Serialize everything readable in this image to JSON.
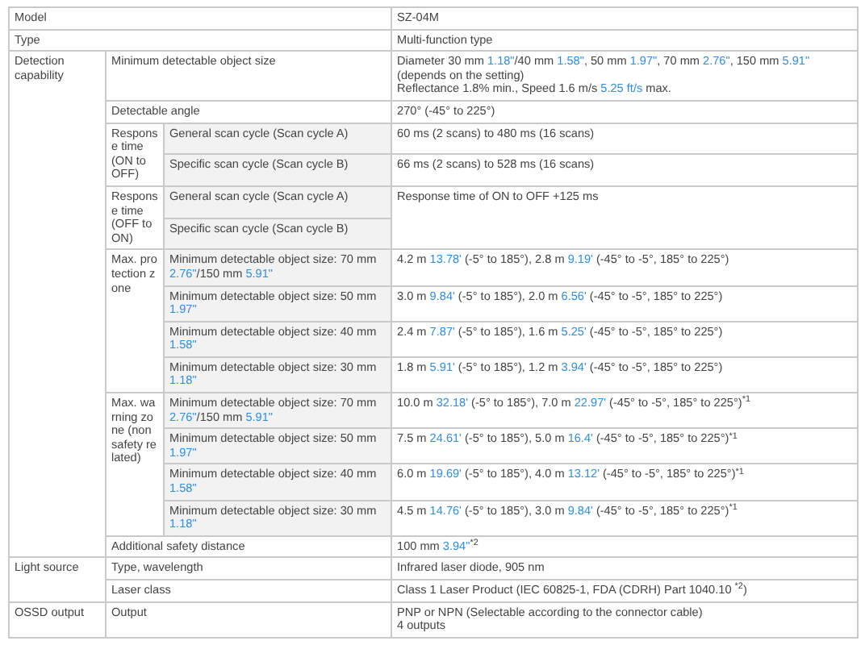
{
  "spec_table": [
    {
      "label": "Model",
      "value": [
        {
          "kind": "text",
          "text": "SZ-04M"
        }
      ]
    },
    {
      "label": "Type",
      "value": [
        {
          "kind": "text",
          "text": "Multi-function type"
        }
      ]
    },
    {
      "label": "Detection capability",
      "items": [
        {
          "label": "Minimum detectable object size",
          "value": [
            {
              "kind": "text",
              "text": "Diameter 30 mm "
            },
            {
              "kind": "imperial",
              "text": "1.18\""
            },
            {
              "kind": "text",
              "text": "/40 mm "
            },
            {
              "kind": "imperial",
              "text": "1.58\""
            },
            {
              "kind": "text",
              "text": ", 50 mm "
            },
            {
              "kind": "imperial",
              "text": "1.97\""
            },
            {
              "kind": "text",
              "text": ", 70 mm "
            },
            {
              "kind": "imperial",
              "text": "2.76\""
            },
            {
              "kind": "text",
              "text": ", 150 mm "
            },
            {
              "kind": "imperial",
              "text": "5.91\""
            },
            {
              "kind": "text",
              "text": " (depends on the setting)"
            },
            {
              "kind": "break"
            },
            {
              "kind": "text",
              "text": "Reflectance 1.8% min., Speed 1.6 m/s "
            },
            {
              "kind": "imperial",
              "text": "5.25 ft/s"
            },
            {
              "kind": "text",
              "text": " max."
            }
          ]
        },
        {
          "label": "Detectable angle",
          "value": [
            {
              "kind": "text",
              "text": "270° (-45° to 225°)"
            }
          ]
        },
        {
          "label": "Response time (ON to OFF)",
          "subitems": [
            {
              "label": "General scan cycle (Scan cycle A)",
              "value": [
                {
                  "kind": "text",
                  "text": "60 ms (2 scans) to 480 ms (16 scans)"
                }
              ]
            },
            {
              "label": "Specific scan cycle (Scan cycle B)",
              "value": [
                {
                  "kind": "text",
                  "text": "66 ms (2 scans) to 528 ms (16 scans)"
                }
              ]
            }
          ]
        },
        {
          "label": "Response time (OFF to ON)",
          "shared_value": [
            {
              "kind": "text",
              "text": "Response time of ON to OFF +125 ms"
            }
          ],
          "subitems": [
            {
              "label": "General scan cycle (Scan cycle A)"
            },
            {
              "label": "Specific scan cycle (Scan cycle B)"
            }
          ]
        },
        {
          "label": "Max. protection zone",
          "subitems": [
            {
              "label": [
                {
                  "kind": "text",
                  "text": "Minimum detectable object size: 70 mm "
                },
                {
                  "kind": "imperial",
                  "text": "2.76\""
                },
                {
                  "kind": "text",
                  "text": "/150 mm "
                },
                {
                  "kind": "imperial",
                  "text": "5.91\""
                }
              ],
              "value": [
                {
                  "kind": "text",
                  "text": "4.2 m "
                },
                {
                  "kind": "imperial",
                  "text": "13.78'"
                },
                {
                  "kind": "text",
                  "text": " (-5° to 185°), 2.8 m "
                },
                {
                  "kind": "imperial",
                  "text": "9.19'"
                },
                {
                  "kind": "text",
                  "text": " (-45° to -5°, 185° to 225°)"
                }
              ]
            },
            {
              "label": [
                {
                  "kind": "text",
                  "text": "Minimum detectable object size: 50 mm "
                },
                {
                  "kind": "imperial",
                  "text": "1.97\""
                }
              ],
              "value": [
                {
                  "kind": "text",
                  "text": "3.0 m "
                },
                {
                  "kind": "imperial",
                  "text": "9.84'"
                },
                {
                  "kind": "text",
                  "text": " (-5° to 185°), 2.0 m "
                },
                {
                  "kind": "imperial",
                  "text": "6.56'"
                },
                {
                  "kind": "text",
                  "text": " (-45° to -5°, 185° to 225°)"
                }
              ]
            },
            {
              "label": [
                {
                  "kind": "text",
                  "text": "Minimum detectable object size: 40 mm "
                },
                {
                  "kind": "imperial",
                  "text": "1.58\""
                }
              ],
              "value": [
                {
                  "kind": "text",
                  "text": "2.4 m "
                },
                {
                  "kind": "imperial",
                  "text": "7.87'"
                },
                {
                  "kind": "text",
                  "text": " (-5° to 185°), 1.6 m "
                },
                {
                  "kind": "imperial",
                  "text": "5.25'"
                },
                {
                  "kind": "text",
                  "text": " (-45° to -5°, 185° to 225°)"
                }
              ]
            },
            {
              "label": [
                {
                  "kind": "text",
                  "text": "Minimum detectable object size: 30 mm "
                },
                {
                  "kind": "imperial",
                  "text": "1.18\""
                }
              ],
              "value": [
                {
                  "kind": "text",
                  "text": "1.8 m "
                },
                {
                  "kind": "imperial",
                  "text": "5.91'"
                },
                {
                  "kind": "text",
                  "text": " (-5° to 185°), 1.2 m "
                },
                {
                  "kind": "imperial",
                  "text": "3.94'"
                },
                {
                  "kind": "text",
                  "text": " (-45° to -5°, 185° to 225°)"
                }
              ]
            }
          ]
        },
        {
          "label": "Max. warning zone (non safety related)",
          "subitems": [
            {
              "label": [
                {
                  "kind": "text",
                  "text": "Minimum detectable object size: 70 mm "
                },
                {
                  "kind": "imperial",
                  "text": "2.76\""
                },
                {
                  "kind": "text",
                  "text": "/150 mm "
                },
                {
                  "kind": "imperial",
                  "text": "5.91\""
                }
              ],
              "value": [
                {
                  "kind": "text",
                  "text": "10.0 m "
                },
                {
                  "kind": "imperial",
                  "text": "32.18'"
                },
                {
                  "kind": "text",
                  "text": " (-5° to 185°), 7.0 m "
                },
                {
                  "kind": "imperial",
                  "text": "22.97'"
                },
                {
                  "kind": "text",
                  "text": " (-45° to -5°, 185° to 225°)$^{*1}$"
                }
              ]
            },
            {
              "label": [
                {
                  "kind": "text",
                  "text": "Minimum detectable object size: 50 mm "
                },
                {
                  "kind": "imperial",
                  "text": "1.97\""
                }
              ],
              "value": [
                {
                  "kind": "text",
                  "text": "7.5 m "
                },
                {
                  "kind": "imperial",
                  "text": "24.61'"
                },
                {
                  "kind": "text",
                  "text": " (-5° to 185°), 5.0 m "
                },
                {
                  "kind": "imperial",
                  "text": "16.4'"
                },
                {
                  "kind": "text",
                  "text": " (-45° to -5°, 185° to 225°)$^{*1}$"
                }
              ]
            },
            {
              "label": [
                {
                  "kind": "text",
                  "text": "Minimum detectable object size: 40 mm "
                },
                {
                  "kind": "imperial",
                  "text": "1.58\""
                }
              ],
              "value": [
                {
                  "kind": "text",
                  "text": "6.0 m "
                },
                {
                  "kind": "imperial",
                  "text": "19.69'"
                },
                {
                  "kind": "text",
                  "text": " (-5° to 185°), 4.0 m "
                },
                {
                  "kind": "imperial",
                  "text": "13.12'"
                },
                {
                  "kind": "text",
                  "text": " (-45° to -5°, 185° to 225°)$^{*1}$"
                }
              ]
            },
            {
              "label": [
                {
                  "kind": "text",
                  "text": "Minimum detectable object size: 30 mm "
                },
                {
                  "kind": "imperial",
                  "text": "1.18\""
                }
              ],
              "value": [
                {
                  "kind": "text",
                  "text": "4.5 m "
                },
                {
                  "kind": "imperial",
                  "text": "14.76'"
                },
                {
                  "kind": "text",
                  "text": " (-5° to 185°), 3.0 m "
                },
                {
                  "kind": "imperial",
                  "text": "9.84'"
                },
                {
                  "kind": "text",
                  "text": " (-45° to -5°, 185° to 225°)$^{*1}$"
                }
              ]
            }
          ]
        },
        {
          "label": "Additional safety distance",
          "value": [
            {
              "kind": "text",
              "text": "100 mm "
            },
            {
              "kind": "imperial",
              "text": "3.94\""
            },
            {
              "kind": "text",
              "text": "$^{*2}$"
            }
          ]
        }
      ]
    },
    {
      "label": "Light source",
      "items": [
        {
          "label": "Type, wavelength",
          "value": [
            {
              "kind": "text",
              "text": "Infrared laser diode, 905 nm"
            }
          ]
        },
        {
          "label": "Laser class",
          "value": [
            {
              "kind": "text",
              "text": "Class 1 Laser Product (IEC 60825-1, FDA (CDRH) Part 1040.10 $^{*2}$)"
            }
          ]
        }
      ]
    },
    {
      "label": "OSSD output",
      "items": [
        {
          "label": "Output",
          "value": [
            {
              "kind": "text",
              "text": "PNP or NPN (Selectable according to the connector cable)"
            },
            {
              "kind": "break"
            },
            {
              "kind": "text",
              "text": "4 outputs"
            }
          ]
        }
      ]
    }
  ]
}
